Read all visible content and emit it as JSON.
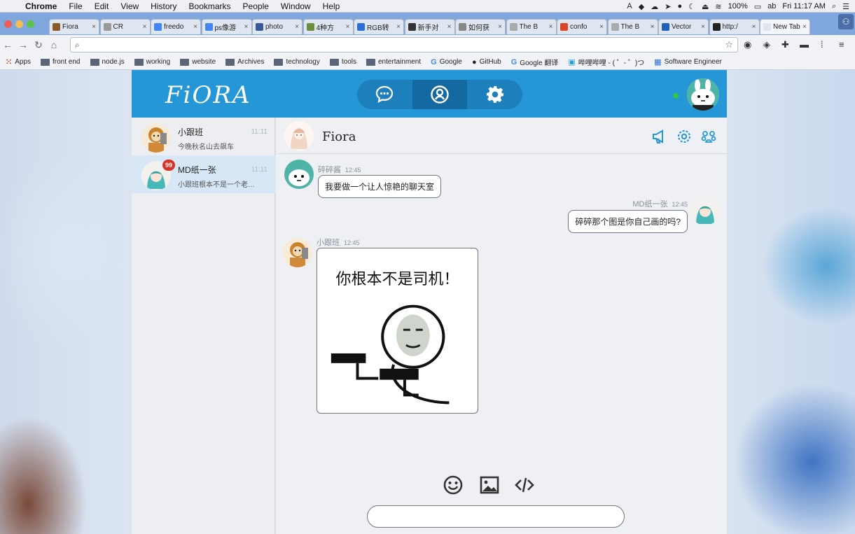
{
  "menubar": {
    "app": "Chrome",
    "items": [
      "File",
      "Edit",
      "View",
      "History",
      "Bookmarks",
      "People",
      "Window",
      "Help"
    ],
    "battery": "100%",
    "clock": "Fri 11:17 AM"
  },
  "tabs": [
    {
      "label": "Fiora",
      "color": "#8b5a2b"
    },
    {
      "label": "CR",
      "color": "#999999"
    },
    {
      "label": "freedo",
      "color": "#4285f4"
    },
    {
      "label": "ps像游",
      "color": "#4285f4"
    },
    {
      "label": "photo",
      "color": "#3b5998"
    },
    {
      "label": "4种方",
      "color": "#6a8f3c"
    },
    {
      "label": "RGB转",
      "color": "#2a6fd6"
    },
    {
      "label": "新手对",
      "color": "#333333"
    },
    {
      "label": "如何获",
      "color": "#888888"
    },
    {
      "label": "The B",
      "color": "#aaaaaa"
    },
    {
      "label": "confo",
      "color": "#d9462b"
    },
    {
      "label": "The B",
      "color": "#aaaaaa"
    },
    {
      "label": "Vector",
      "color": "#1c62b9"
    },
    {
      "label": "http:/",
      "color": "#222222"
    },
    {
      "label": "New Tab",
      "color": "#dfe6f0"
    }
  ],
  "omnibox": {
    "placeholder": ""
  },
  "bookmarks": [
    {
      "label": "Apps",
      "kind": "apps"
    },
    {
      "label": "front end",
      "kind": "folder"
    },
    {
      "label": "node.js",
      "kind": "folder"
    },
    {
      "label": "working",
      "kind": "folder"
    },
    {
      "label": "website",
      "kind": "folder"
    },
    {
      "label": "Archives",
      "kind": "folder"
    },
    {
      "label": "technology",
      "kind": "folder"
    },
    {
      "label": "tools",
      "kind": "folder"
    },
    {
      "label": "entertainment",
      "kind": "folder"
    },
    {
      "label": "Google",
      "kind": "google"
    },
    {
      "label": "GitHub",
      "kind": "github"
    },
    {
      "label": "Google 翻译",
      "kind": "google"
    },
    {
      "label": "哔哩哔哩 - ( ゜- ゜)つ",
      "kind": "bilibili"
    },
    {
      "label": "Software Engineer",
      "kind": "site"
    }
  ],
  "app": {
    "logo": "FiORA",
    "accent": "#2597d6"
  },
  "conversations": [
    {
      "name": "小跟班",
      "preview": "今晚秋名山去飙车",
      "time": "11:11",
      "badge": ""
    },
    {
      "name": "MD纸一张",
      "preview": "小跟班根本不是一个老司机",
      "time": "11:11",
      "badge": "99"
    }
  ],
  "chat": {
    "title": "Fiora",
    "messages": [
      {
        "sender": "碎碎酱",
        "time": "12:45",
        "text": "我要做一个让人惊艳的聊天室"
      },
      {
        "sender": "MD纸一张",
        "time": "12:45",
        "text": "碎碎那个图是你自己画的吗?"
      },
      {
        "sender": "小跟班",
        "time": "12:45",
        "caption": "你根本不是司机！"
      }
    ],
    "input_placeholder": ""
  }
}
